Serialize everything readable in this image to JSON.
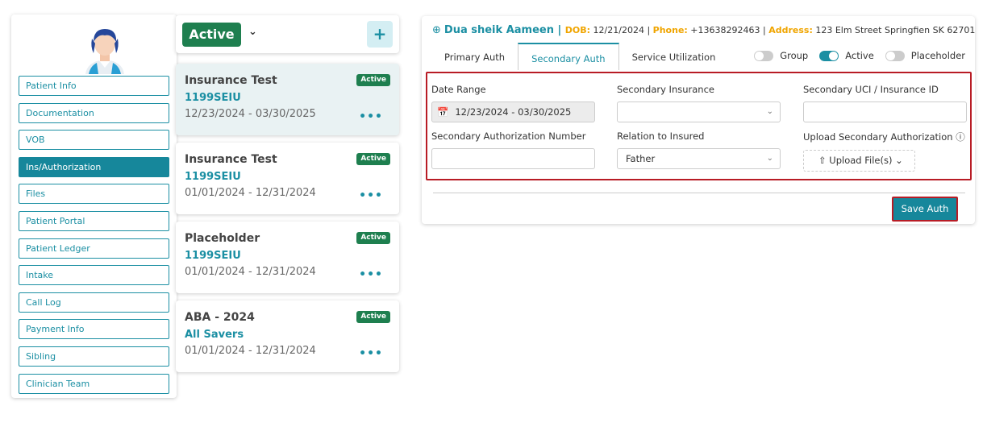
{
  "sidebar": {
    "avatar_icon": "doctor-avatar-icon",
    "items": [
      {
        "label": "Patient Info"
      },
      {
        "label": "Documentation"
      },
      {
        "label": "VOB"
      },
      {
        "label": "Ins/Authorization"
      },
      {
        "label": "Files"
      },
      {
        "label": "Patient Portal"
      },
      {
        "label": "Patient Ledger"
      },
      {
        "label": "Intake"
      },
      {
        "label": "Call Log"
      },
      {
        "label": "Payment Info"
      },
      {
        "label": "Sibling"
      },
      {
        "label": "Clinician Team"
      }
    ],
    "active_index": 3
  },
  "filter": {
    "status": "Active",
    "add_icon": "plus-icon"
  },
  "auth_cards": [
    {
      "title": "Insurance Test",
      "code": "1199SEIU",
      "dates": "12/23/2024 - 03/30/2025",
      "badge": "Active"
    },
    {
      "title": "Insurance Test",
      "code": "1199SEIU",
      "dates": "01/01/2024 - 12/31/2024",
      "badge": "Active"
    },
    {
      "title": "Placeholder",
      "code": "1199SEIU",
      "dates": "01/01/2024 - 12/31/2024",
      "badge": "Active"
    },
    {
      "title": "ABA - 2024",
      "code": "All Savers",
      "dates": "01/01/2024 - 12/31/2024",
      "badge": "Active"
    }
  ],
  "patient": {
    "name": "Dua sheik Aameen",
    "sep": " | ",
    "dob_label": "DOB:",
    "dob": " 12/21/2024 | ",
    "phone_label": "Phone:",
    "phone": " +13638292463 | ",
    "address_label": "Address:",
    "address": " 123 Elm Street Springfien SK 62701"
  },
  "tabs": [
    {
      "label": "Primary Auth"
    },
    {
      "label": "Secondary Auth"
    },
    {
      "label": "Service Utilization"
    }
  ],
  "toggles": [
    {
      "label": "Group",
      "on": false
    },
    {
      "label": "Active",
      "on": true
    },
    {
      "label": "Placeholder",
      "on": false
    }
  ],
  "form": {
    "date_range_label": "Date Range",
    "date_range_value": "12/23/2024 - 03/30/2025",
    "secondary_insurance_label": "Secondary Insurance",
    "secondary_insurance_value": "",
    "secondary_uci_label": "Secondary UCI / Insurance ID",
    "secondary_uci_value": "",
    "auth_number_label": "Secondary Authorization Number",
    "auth_number_value": "",
    "relation_label": "Relation to Insured",
    "relation_value": "Father",
    "upload_label": "Upload Secondary Authorization",
    "upload_button": "Upload File(s)"
  },
  "actions": {
    "save": "Save Auth"
  },
  "colors": {
    "accent": "#1b8fa3",
    "active_green": "#1e7f4f",
    "highlight_red": "#b81c25",
    "label_orange": "#f0a500"
  }
}
